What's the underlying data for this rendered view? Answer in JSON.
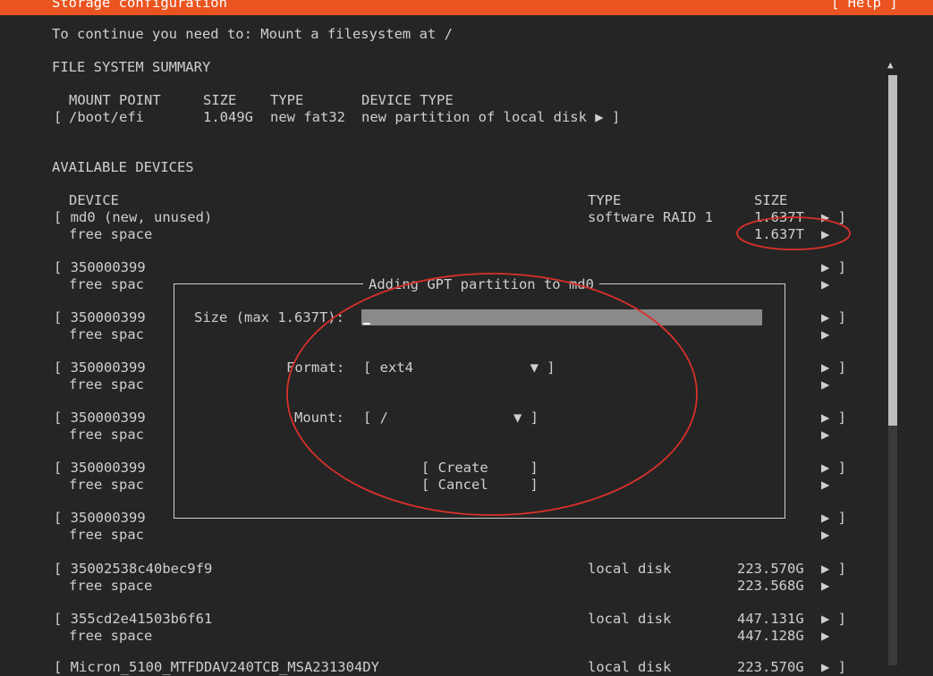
{
  "header": {
    "title": "Storage configuration",
    "help_label": "[ Help ]"
  },
  "instruction": "To continue you need to: Mount a filesystem at /",
  "summary": {
    "heading": "FILE SYSTEM SUMMARY",
    "columns": [
      "MOUNT POINT",
      "SIZE",
      "TYPE",
      "DEVICE TYPE"
    ],
    "row": {
      "open": "[",
      "mount": "/boot/efi",
      "size": "1.049G",
      "type": "new fat32",
      "device_type": "new partition of local disk ▶ ]"
    }
  },
  "devices": {
    "heading": "AVAILABLE DEVICES",
    "columns": [
      "DEVICE",
      "TYPE",
      "SIZE"
    ],
    "md0": {
      "name": "[ md0 (new, unused)",
      "type": "software RAID 1",
      "size": "1.637T",
      "free_label": "free space",
      "free_size": "1.637T"
    },
    "disk_rows": [
      {
        "name": "[ 350000399",
        "free": "free spac"
      },
      {
        "name": "[ 350000399",
        "free": "free spac"
      },
      {
        "name": "[ 350000399",
        "free": "free spac"
      },
      {
        "name": "[ 350000399",
        "free": "free spac"
      },
      {
        "name": "[ 350000399",
        "free": "free spac"
      },
      {
        "name": "[ 350000399",
        "free": "free spac"
      }
    ],
    "local1": {
      "name": "[ 35002538c40bec9f9",
      "type": "local disk",
      "size": "223.570G",
      "free_label": "free space",
      "free_size": "223.568G"
    },
    "local2": {
      "name": "[ 355cd2e41503b6f61",
      "type": "local disk",
      "size": "447.131G",
      "free_label": "free space",
      "free_size": "447.128G"
    },
    "local3": {
      "name": "[ Micron_5100_MTFDDAV240TCB_MSA231304DY",
      "type": "local disk",
      "size": "223.570G"
    },
    "row_arrow": "▶ ]",
    "free_arrow": "▶"
  },
  "dialog": {
    "title": "Adding GPT partition to md0",
    "size_label": "Size (max 1.637T):",
    "size_value": "",
    "format_label": "Format:",
    "format_value": "[ ext4              ▼ ]",
    "mount_label": "Mount:",
    "mount_value": "[ /               ▼ ]",
    "create_label": "[ Create     ]",
    "cancel_label": "[ Cancel     ]"
  },
  "colors": {
    "header_bg": "#e95420",
    "background": "#252525",
    "text": "#cfcfcf",
    "annotation": "#d8302a"
  }
}
